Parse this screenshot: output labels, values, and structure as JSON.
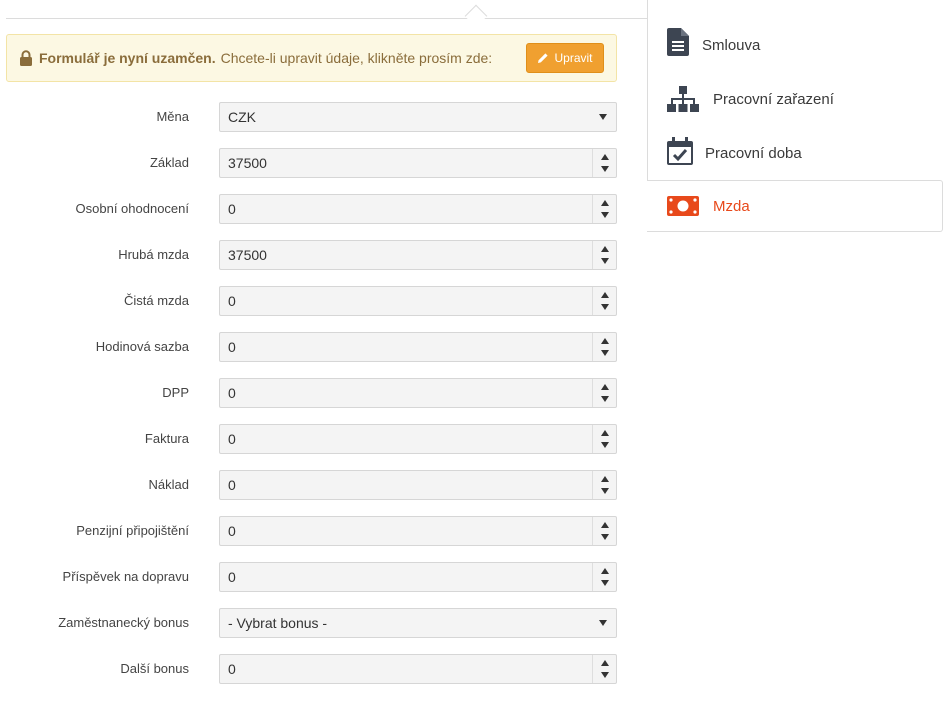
{
  "alert": {
    "strong": "Formulář je nyní uzamčen.",
    "text": "Chcete-li upravit údaje, klikněte prosím zde:",
    "button_label": "Upravit"
  },
  "form": {
    "fields": [
      {
        "label": "Měna",
        "value": "CZK",
        "type": "select"
      },
      {
        "label": "Základ",
        "value": "37500",
        "type": "number"
      },
      {
        "label": "Osobní ohodnocení",
        "value": "0",
        "type": "number"
      },
      {
        "label": "Hrubá mzda",
        "value": "37500",
        "type": "number"
      },
      {
        "label": "Čistá mzda",
        "value": "0",
        "type": "number"
      },
      {
        "label": "Hodinová sazba",
        "value": "0",
        "type": "number"
      },
      {
        "label": "DPP",
        "value": "0",
        "type": "number"
      },
      {
        "label": "Faktura",
        "value": "0",
        "type": "number"
      },
      {
        "label": "Náklad",
        "value": "0",
        "type": "number"
      },
      {
        "label": "Penzijní připojištění",
        "value": "0",
        "type": "number"
      },
      {
        "label": "Příspěvek na dopravu",
        "value": "0",
        "type": "number"
      },
      {
        "label": "Zaměstnanecký bonus",
        "value": "- Vybrat bonus -",
        "type": "select"
      },
      {
        "label": "Další bonus",
        "value": "0",
        "type": "number"
      }
    ]
  },
  "sidebar": {
    "tabs": [
      {
        "label": "Smlouva",
        "icon": "document-icon"
      },
      {
        "label": "Pracovní zařazení",
        "icon": "org-chart-icon"
      },
      {
        "label": "Pracovní doba",
        "icon": "calendar-check-icon"
      },
      {
        "label": "Mzda",
        "icon": "money-icon",
        "active": true
      }
    ]
  },
  "colors": {
    "accent": "#e8491b",
    "alert_bg": "#fcf8e3",
    "alert_text": "#8a6d3b",
    "button": "#f0a030",
    "icon_dark": "#3d4552"
  }
}
